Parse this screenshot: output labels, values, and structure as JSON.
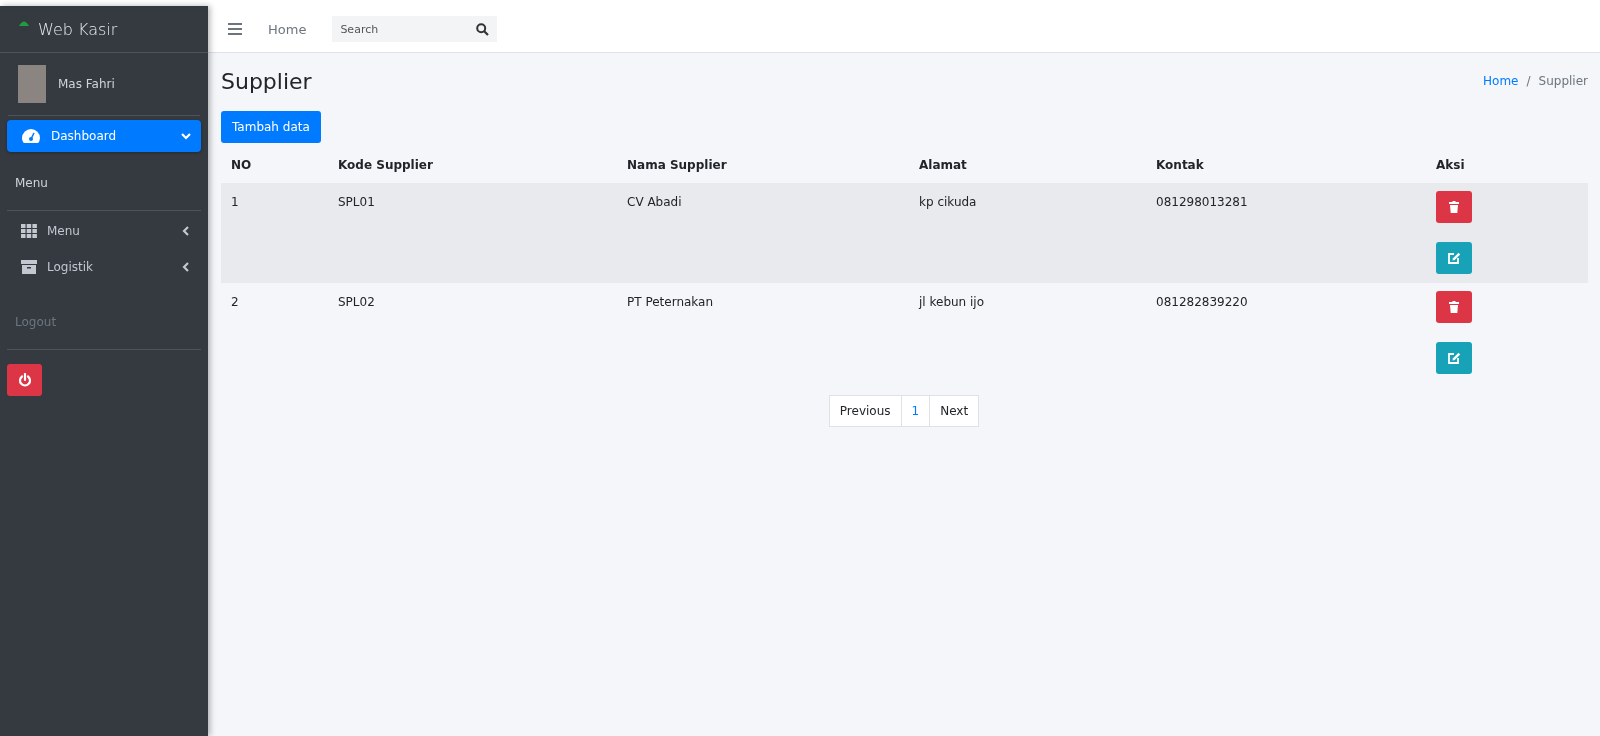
{
  "sidebar": {
    "brand": "Web Kasir",
    "user": {
      "name": "Mas Fahri"
    },
    "items": [
      {
        "kind": "nav",
        "label": "Dashboard",
        "selected": true,
        "expanded": true
      },
      {
        "kind": "header",
        "label": "Menu"
      },
      {
        "kind": "nav",
        "label": "Menu",
        "selected": false,
        "expanded": false
      },
      {
        "kind": "nav",
        "label": "Logistik",
        "selected": false,
        "expanded": false
      },
      {
        "kind": "header",
        "label": "Logout",
        "disabled": true
      },
      {
        "kind": "power"
      }
    ]
  },
  "navbar": {
    "home": "Home",
    "search": {
      "placeholder": "Search"
    }
  },
  "page": {
    "title": "Supplier",
    "breadcrumb": [
      "Home",
      "Supplier"
    ],
    "breadcrumb_separator": "/",
    "add_button": "Tambah data"
  },
  "table": {
    "columns": [
      "NO",
      "Kode Supplier",
      "Nama Supplier",
      "Alamat",
      "Kontak",
      "Aksi"
    ],
    "rows": [
      {
        "cells": [
          "1",
          "SPL01",
          "CV Abadi",
          "kp cikuda",
          "081298013281"
        ]
      },
      {
        "cells": [
          "2",
          "SPL02",
          "PT Peternakan",
          "jl kebun ijo",
          "081282839220"
        ]
      }
    ]
  },
  "pagination": [
    "Previous",
    "1",
    "Next"
  ]
}
